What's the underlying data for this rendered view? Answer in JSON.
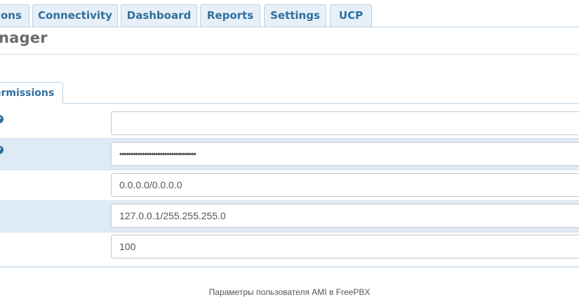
{
  "nav": {
    "tabs": [
      {
        "label": "ons"
      },
      {
        "label": "Connectivity"
      },
      {
        "label": "Dashboard"
      },
      {
        "label": "Reports"
      },
      {
        "label": "Settings"
      },
      {
        "label": "UCP"
      }
    ]
  },
  "page": {
    "title": "nager",
    "breadcrumb": ":"
  },
  "subtab": {
    "label": "ermissions"
  },
  "form": {
    "help_glyph": "?",
    "fields": [
      {
        "value": ""
      },
      {
        "value": "••••••••••••••••••••••••••••••••••"
      },
      {
        "value": "0.0.0.0/0.0.0.0"
      },
      {
        "value": "127.0.0.1/255.255.255.0"
      },
      {
        "value": "100"
      }
    ]
  },
  "caption": "Параметры пользователя AMI в FreePBX",
  "colors": {
    "accent": "#2f6f9d",
    "row_alt": "#deeaf5",
    "tab_bg": "#e7f0f8"
  }
}
